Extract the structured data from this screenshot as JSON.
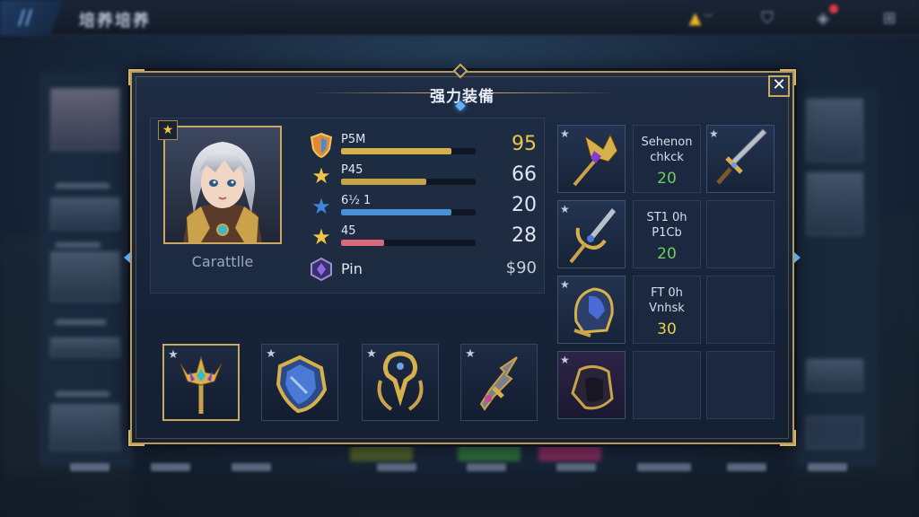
{
  "topbar": {
    "menu_glyph": "//",
    "title": "培养培养",
    "icons": [
      "bell-icon",
      "shield-icon",
      "gift-icon",
      "grid-icon"
    ]
  },
  "dialog": {
    "title": "强力装備",
    "close_glyph": "✕"
  },
  "hero": {
    "name": "Carattlle",
    "star_glyph": "★"
  },
  "stats": [
    {
      "label": "P5M",
      "value": "95",
      "fill": 0.82,
      "color": "#d6b04a",
      "value_color": "#f0c545",
      "icon": "shield-badge-icon"
    },
    {
      "label": "P45",
      "value": "66",
      "fill": 0.63,
      "color": "#c9a24a",
      "value_color": "#dfe6f2",
      "icon": "gold-star-icon"
    },
    {
      "label": "6½ 1",
      "value": "20",
      "fill": 0.82,
      "color": "#4a90d6",
      "value_color": "#dfe6f2",
      "icon": "blue-star-icon"
    },
    {
      "label": "45",
      "value": "28",
      "fill": 0.32,
      "color": "#d66a7a",
      "value_color": "#dfe6f2",
      "icon": "gold-star-icon"
    },
    {
      "label": "Pin",
      "value": "$90",
      "fill": null,
      "color": "",
      "value_color": "#c7ceda",
      "icon": "purple-gem-icon"
    }
  ],
  "equipment_slots": [
    {
      "name": "trident-slot",
      "star": "★",
      "selected": true
    },
    {
      "name": "shield-slot",
      "star": "★",
      "selected": false
    },
    {
      "name": "amulet-slot",
      "star": "★",
      "selected": false
    },
    {
      "name": "blade-slot",
      "star": "★",
      "selected": false
    }
  ],
  "inventory_info": [
    {
      "name": "Sehenon chkck",
      "num": "20",
      "num_color": "#6fcf5a"
    },
    {
      "name": "ST1 0h P1Cb",
      "num": "20",
      "num_color": "#6fcf5a"
    },
    {
      "name": "FT 0h Vnhsk",
      "num": "30",
      "num_color": "#e6d24a"
    }
  ],
  "inventory_plus": "★"
}
